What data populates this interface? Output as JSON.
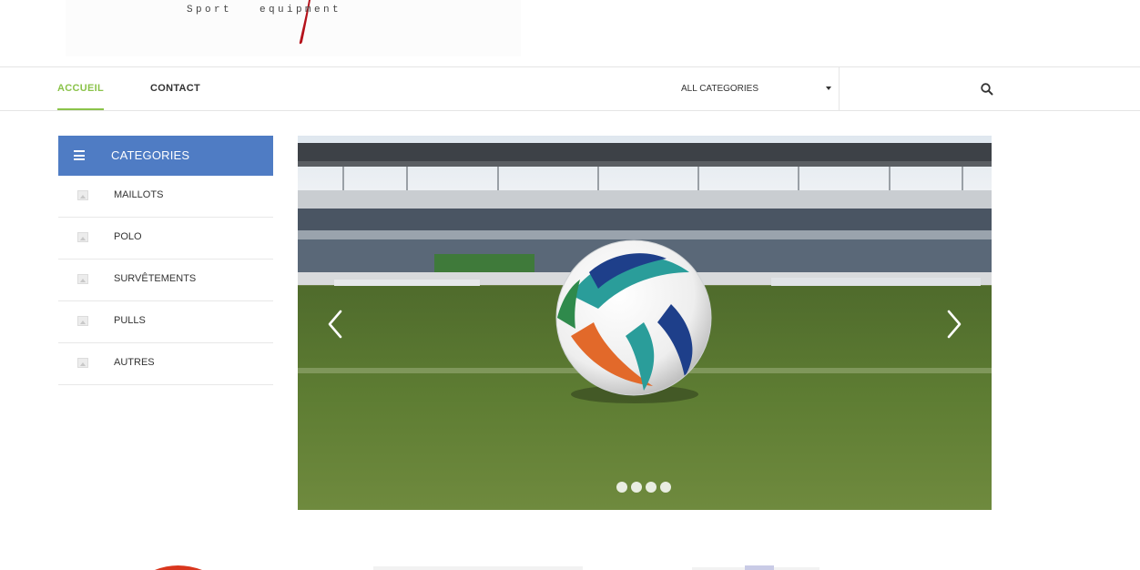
{
  "header": {
    "logo_tagline": "Sport   equipment",
    "brand_red": "#b5121b"
  },
  "nav": {
    "items": [
      {
        "label": "ACCUEIL",
        "active": true
      },
      {
        "label": "CONTACT",
        "active": false
      }
    ],
    "accent": "#8bc34a"
  },
  "search": {
    "category_selected": "ALL CATEGORIES",
    "placeholder": "",
    "button_icon": "search-icon"
  },
  "sidebar": {
    "title": "CATEGORIES",
    "header_color": "#4f7cc4",
    "items": [
      {
        "label": "MAILLOTS"
      },
      {
        "label": "POLO"
      },
      {
        "label": "SURVÊTEMENTS"
      },
      {
        "label": "PULLS"
      },
      {
        "label": "AUTRES"
      }
    ]
  },
  "slider": {
    "image": "soccer-ball-on-stadium-grass",
    "slides_count": 4,
    "active_slide": 1,
    "prev_icon": "chevron-left-icon",
    "next_icon": "chevron-right-icon"
  }
}
